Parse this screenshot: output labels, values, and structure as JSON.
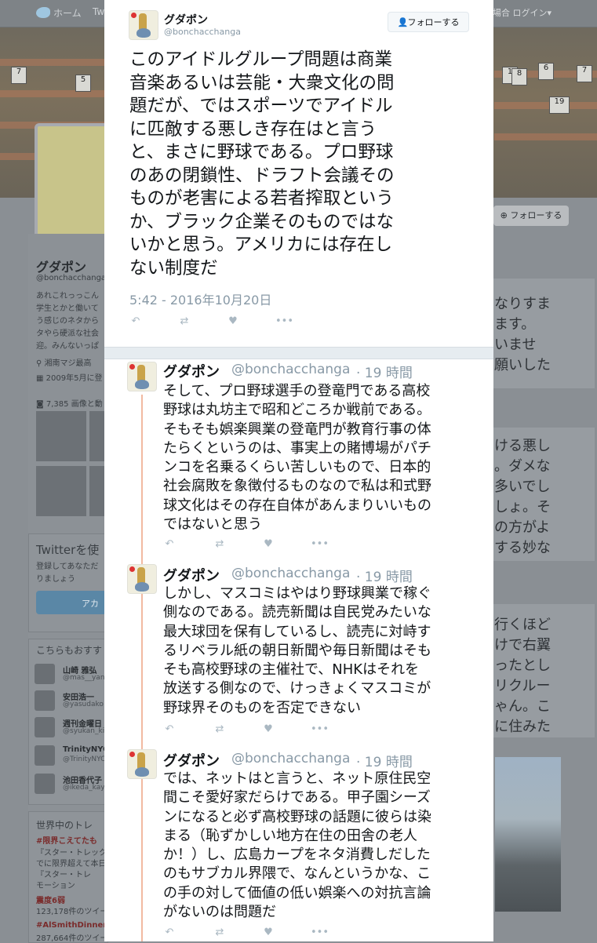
{
  "background": {
    "topbar": {
      "home_label": "ホーム",
      "tab2": "Tw",
      "login_label": "の場合 ログイン▾"
    },
    "banner_signs": [
      "7",
      "5",
      "1",
      "6",
      "8",
      "7",
      "19"
    ],
    "profile": {
      "name": "グダポン",
      "handle": "@bonchacchanga",
      "bio": [
        "あれこれっっこん",
        "学生とかと働いて",
        "う感じのネタから",
        "タやら硬派な社会",
        "迎。みんないっぱ"
      ],
      "location": "湘南マジ最高",
      "joined": "2009年5月に登",
      "media_label": "7,385 画像と動"
    },
    "follow_label_right": "フォローする",
    "join_card": {
      "title": "Twitterを使",
      "text1": "登録してあなただ",
      "text2": "りましょう",
      "button": "アカ"
    },
    "who_to_follow": {
      "title": "こちらもおすす",
      "users": [
        {
          "name": "山崎 雅弘",
          "handle": "@mas__yan"
        },
        {
          "name": "安田浩一",
          "handle": "@yasudako"
        },
        {
          "name": "週刊金曜日",
          "handle": "@syukan_ki"
        },
        {
          "name": "TrinityNYC",
          "handle": "@TrinityNYC"
        },
        {
          "name": "池田香代子",
          "handle": "@ikeda_kay"
        }
      ]
    },
    "trends": {
      "title": "世界中のトレ",
      "items": [
        {
          "tag": "#限界こえてたも",
          "desc1": "『スター・トレック",
          "desc2": "でに限界超えて本日",
          "desc3": "『スター・トレ",
          "desc4": "モーション"
        },
        {
          "tag": "震度6弱",
          "desc1": "123,178件のツイー"
        },
        {
          "tag": "#AlSmithDinner",
          "desc1": "287,664件のツイー"
        }
      ]
    },
    "right_text_1": [
      "なりすま",
      "ます。",
      "いませ",
      "願いした"
    ],
    "right_text_2": [
      "ける悪し",
      "。ダメな",
      "多いでし",
      "しょ。そ",
      "の方がよ",
      "する妙な"
    ],
    "right_text_3": [
      "行くほど",
      "けで右翼",
      "ったとし",
      "リクルー",
      "ゃん。こ",
      "に住みた"
    ]
  },
  "main_tweet": {
    "author_name": "グダポン",
    "author_handle": "@bonchacchanga",
    "follow_label": "フォローする",
    "text_lines": [
      "このアイドルグループ問題は商業",
      "音楽あるいは芸能・大衆文化の問",
      "題だが、ではスポーツでアイドル",
      "に匹敵する悪しき存在はと言う",
      "と、まさに野球である。プロ野球",
      "のあの閉鎖性、ドラフト会議その",
      "ものが老害による若者搾取という",
      "か、ブラック企業そのものではな",
      "いかと思う。アメリカには存在し",
      "ない制度だ"
    ],
    "timestamp": "5:42 - 2016年10月20日"
  },
  "replies": [
    {
      "author_name": "グダポン",
      "author_handle": "@bonchacchanga",
      "time": "· 19 時間",
      "text_lines": [
        "そして、プロ野球選手の登竜門である高校",
        "野球は丸坊主で昭和どころか戦前である。",
        "そもそも娯楽興業の登竜門が教育行事の体",
        "たらくというのは、事実上の賭博場がパチ",
        "ンコを名乗るくらい苦しいもので、日本的",
        "社会腐敗を象徴付るものなので私は和式野",
        "球文化はその存在自体があんまりいいもの",
        "ではないと思う"
      ]
    },
    {
      "author_name": "グダポン",
      "author_handle": "@bonchacchanga",
      "time": "· 19 時間",
      "text_lines": [
        "しかし、マスコミはやはり野球興業で稼ぐ",
        "側なのである。読売新聞は自民党みたいな",
        "最大球団を保有しているし、読売に対峙す",
        "るリベラル紙の朝日新聞や毎日新聞はそも",
        "そも高校野球の主催社で、NHKはそれを",
        "放送する側なので、けっきょくマスコミが",
        "野球界そのものを否定できない"
      ]
    },
    {
      "author_name": "グダポン",
      "author_handle": "@bonchacchanga",
      "time": "· 19 時間",
      "text_lines": [
        "では、ネットはと言うと、ネット原住民空",
        "間こそ愛好家だらけである。甲子園シーズ",
        "ンになると必ず高校野球の話題に彼らは染",
        "まる（恥ずかしい地方在住の田舎の老人",
        "か！）し、広島カープをネタ消費しだした",
        "のもサブカル界隈で、なんというかな、こ",
        "の手の対して価値の低い娯楽への対抗言論",
        "がないのは問題だ"
      ]
    }
  ],
  "icons": {
    "reply": "reply-icon",
    "retweet": "retweet-icon",
    "like": "heart-icon",
    "more": "more-icon",
    "follow": "person-add-icon"
  }
}
